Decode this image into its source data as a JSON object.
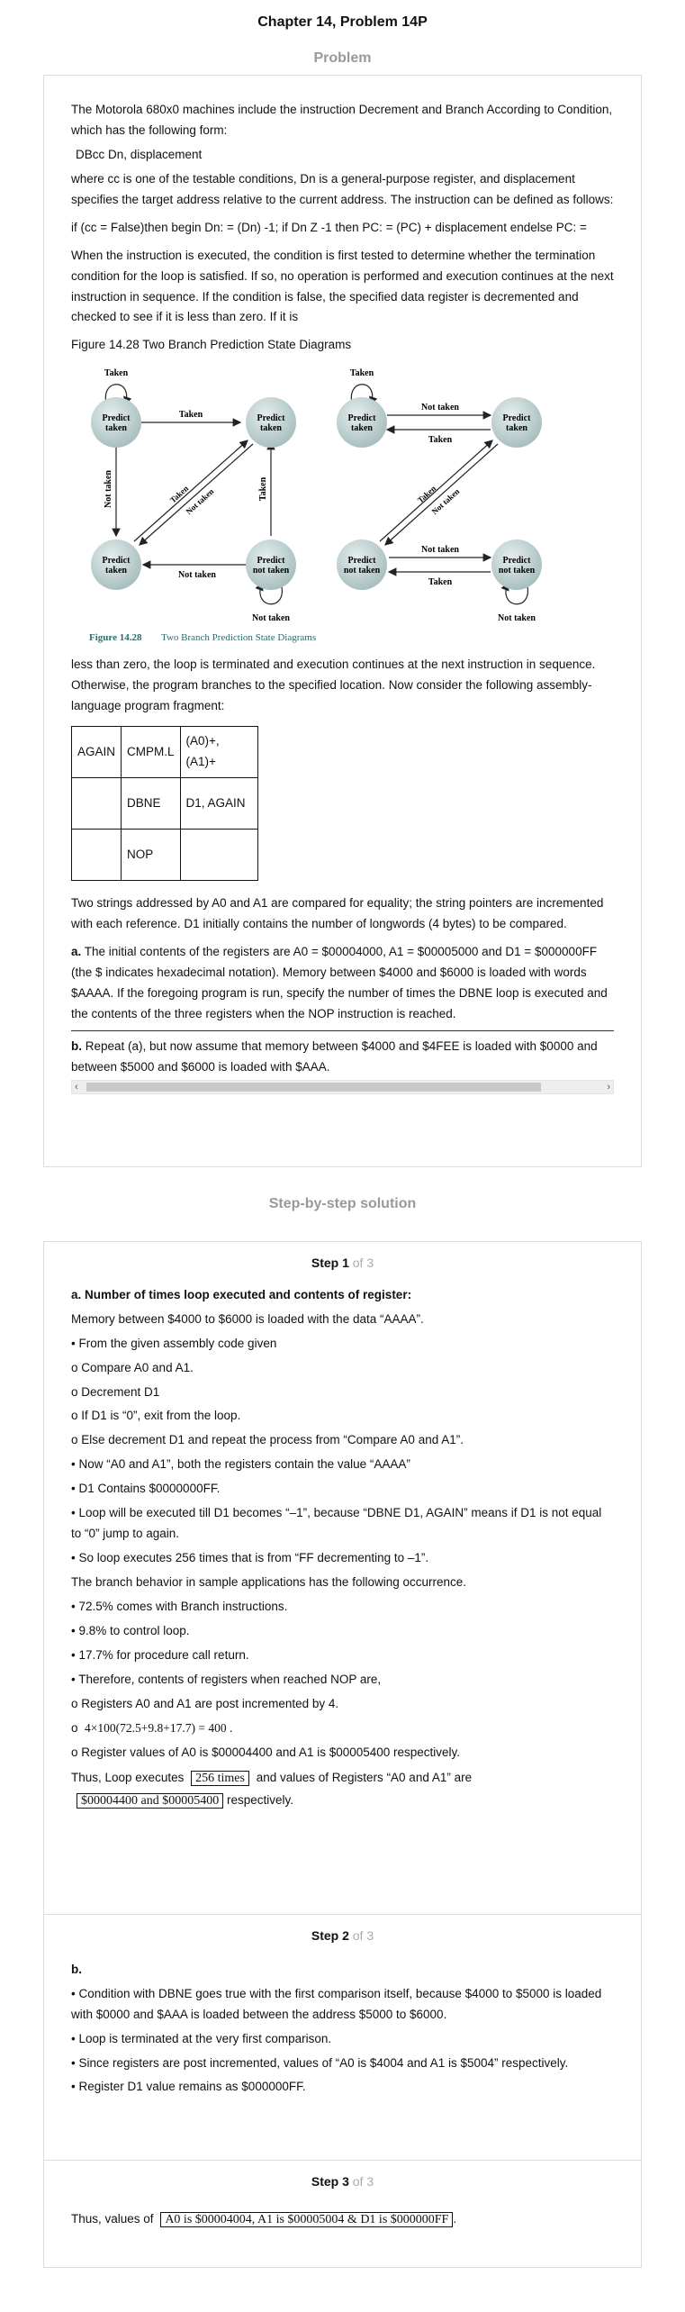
{
  "page_title": "Chapter 14, Problem 14P",
  "problem_heading": "Problem",
  "problem": {
    "intro": "The Motorola 680x0 machines include the instruction Decrement and Branch According to Condition, which has the following form:",
    "form": "DBcc Dn, displacement",
    "where": "where cc is one of the testable conditions, Dn is a general-purpose register, and displacement specifies the target address relative to the current address. The instruction can be defined as follows:",
    "definition": "if (cc = False)then begin Dn: = (Dn) -1; if Dn Z -1 then PC: = (PC) + displacement endelse PC: =",
    "when": "When the instruction is executed, the condition is first tested to determine whether the termination condition for the loop is satisfied. If so, no operation is performed and execution continues at the next instruction in sequence. If the condition is false, the specified data register is decremented and checked to see if it is less than zero. If it is",
    "figure_caption_text": "Figure 14.28 Two Branch Prediction State Diagrams",
    "figure": {
      "caption_number": "Figure 14.28",
      "caption_title": "Two Branch Prediction State Diagrams",
      "state_predict_taken_l1": "Predict",
      "state_predict_taken_l2": "taken",
      "state_predict_not_taken_l2": "not taken",
      "label_taken": "Taken",
      "label_not_taken": "Not taken"
    },
    "less": "less than zero, the loop is terminated and execution continues at the next instruction in sequence. Otherwise, the program branches to the specified location. Now consider the following assembly- language program fragment:",
    "code_table": [
      [
        "AGAIN",
        "CMPM.L",
        "(A0)+, (A1)+"
      ],
      [
        "",
        "DBNE",
        "D1, AGAIN"
      ],
      [
        "",
        "NOP",
        ""
      ]
    ],
    "two_strings": "Two strings addressed by A0 and A1 are compared for equality; the string pointers are incremented with each reference. D1 initially contains the number of longwords (4 bytes) to be compared.",
    "part_a_label": "a.",
    "part_a": "The initial contents of the registers are A0 = $00004000, A1 = $00005000 and D1 = $000000FF (the $ indicates hexadecimal notation). Memory between $4000 and $6000 is loaded with words $AAAA. If the foregoing program is run, specify the number of times the DBNE loop is executed and the contents of the three registers when the NOP instruction is reached.",
    "part_b_label": "b.",
    "part_b": "Repeat (a), but now assume that memory between $4000 and $4FEE is loaded with $0000 and between $5000 and $6000 is loaded with $AAA."
  },
  "solution_heading": "Step-by-step solution",
  "steps": [
    {
      "label": "Step 1",
      "of": "of 3",
      "heading": "a. Number of times loop executed and contents of register:",
      "lines": [
        "Memory between $4000 to $6000 is loaded with the data “AAAA”.",
        "• From the given assembly code given",
        "o Compare A0 and A1.",
        "o Decrement D1",
        "o If D1 is “0”, exit from the loop.",
        "o Else decrement D1 and repeat the process from “Compare A0 and A1”.",
        "• Now “A0 and A1”, both the registers contain the value “AAAA”",
        "• D1 Contains $0000000FF.",
        "• Loop will be executed till D1 becomes “–1”, because “DBNE D1, AGAIN” means if D1 is not equal to “0” jump to again.",
        "• So loop executes 256 times that is from “FF decrementing to –1”.",
        "The branch behavior in sample applications has the following occurrence.",
        "• 72.5% comes with Branch instructions.",
        "• 9.8% to control loop.",
        "• 17.7% for procedure call return.",
        "• Therefore, contents of registers when reached NOP are,",
        "o Registers A0 and A1 are post incremented by 4."
      ],
      "formula_prefix": "o",
      "formula": "4×100(72.5+9.8+17.7) = 400 .",
      "after": "o Register values of A0 is $00004400 and A1 is $00005400 respectively.",
      "thus_pre": "Thus, Loop executes",
      "thus_box1": "256 times",
      "thus_mid": "and values of Registers “A0 and A1” are",
      "thus_box2": "$00004400 and $00005400",
      "thus_post": "respectively."
    },
    {
      "label": "Step 2",
      "of": "of 3",
      "heading": "b.",
      "lines": [
        "• Condition with DBNE goes true with the first comparison itself, because $4000 to $5000 is loaded with $0000 and $AAA is loaded between the address $5000 to $6000.",
        "• Loop is terminated at the very first comparison.",
        "• Since registers are post incremented, values of “A0 is $4004 and A1 is $5004” respectively.",
        "• Register D1 value remains as $000000FF."
      ]
    },
    {
      "label": "Step 3",
      "of": "of 3",
      "thus_pre": "Thus, values of",
      "thus_box": "A0 is $00004004, A1 is $00005004 & D1 is $000000FF",
      "thus_post": "."
    }
  ],
  "colors": {
    "node_fill": "#c9d8d8",
    "caption": "#2f6b6b",
    "heading_gray": "#999999"
  }
}
